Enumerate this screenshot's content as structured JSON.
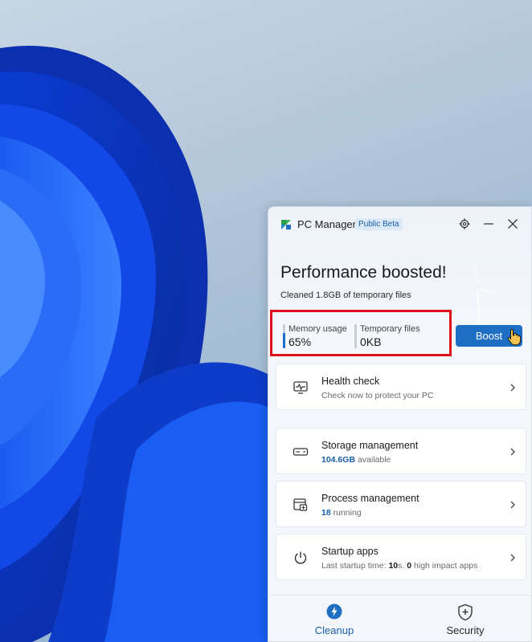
{
  "window": {
    "title": "PC Manager",
    "badge": "Public Beta",
    "icons": [
      "app-logo-icon",
      "gear-icon",
      "minimize-icon",
      "close-icon"
    ]
  },
  "hero": {
    "title": "Performance boosted!",
    "subtitle": "Cleaned 1.8GB of temporary files"
  },
  "stats": {
    "memory": {
      "label": "Memory usage",
      "value": "65%",
      "level": 0.65
    },
    "temp": {
      "label": "Temporary files",
      "value": "0KB",
      "level": 0
    }
  },
  "boost_label": "Boost",
  "cards": [
    {
      "title": "Health check",
      "subtitle": "Check now to protect your PC",
      "icon": "pulse-monitor-icon"
    },
    {
      "title": "Storage management",
      "highlight": "104.6GB",
      "subtitle_rest": "available",
      "icon": "drive-icon"
    },
    {
      "title": "Process management",
      "highlight": "18",
      "subtitle_rest": "running",
      "icon": "process-icon"
    },
    {
      "title": "Startup apps",
      "subtitle_pre": "Last startup time:",
      "time_value": "10",
      "time_unit": "s.",
      "impact_value": "0",
      "subtitle_rest": "high impact apps",
      "icon": "power-icon"
    }
  ],
  "nav": {
    "cleanup": {
      "label": "Cleanup",
      "icon": "lightning-icon",
      "active": true
    },
    "security": {
      "label": "Security",
      "icon": "shield-icon",
      "active": false
    }
  },
  "colors": {
    "accent": "#1e6fc4",
    "highlight_box": "#e0101a",
    "wallpaper_blue": "#1254e0"
  }
}
